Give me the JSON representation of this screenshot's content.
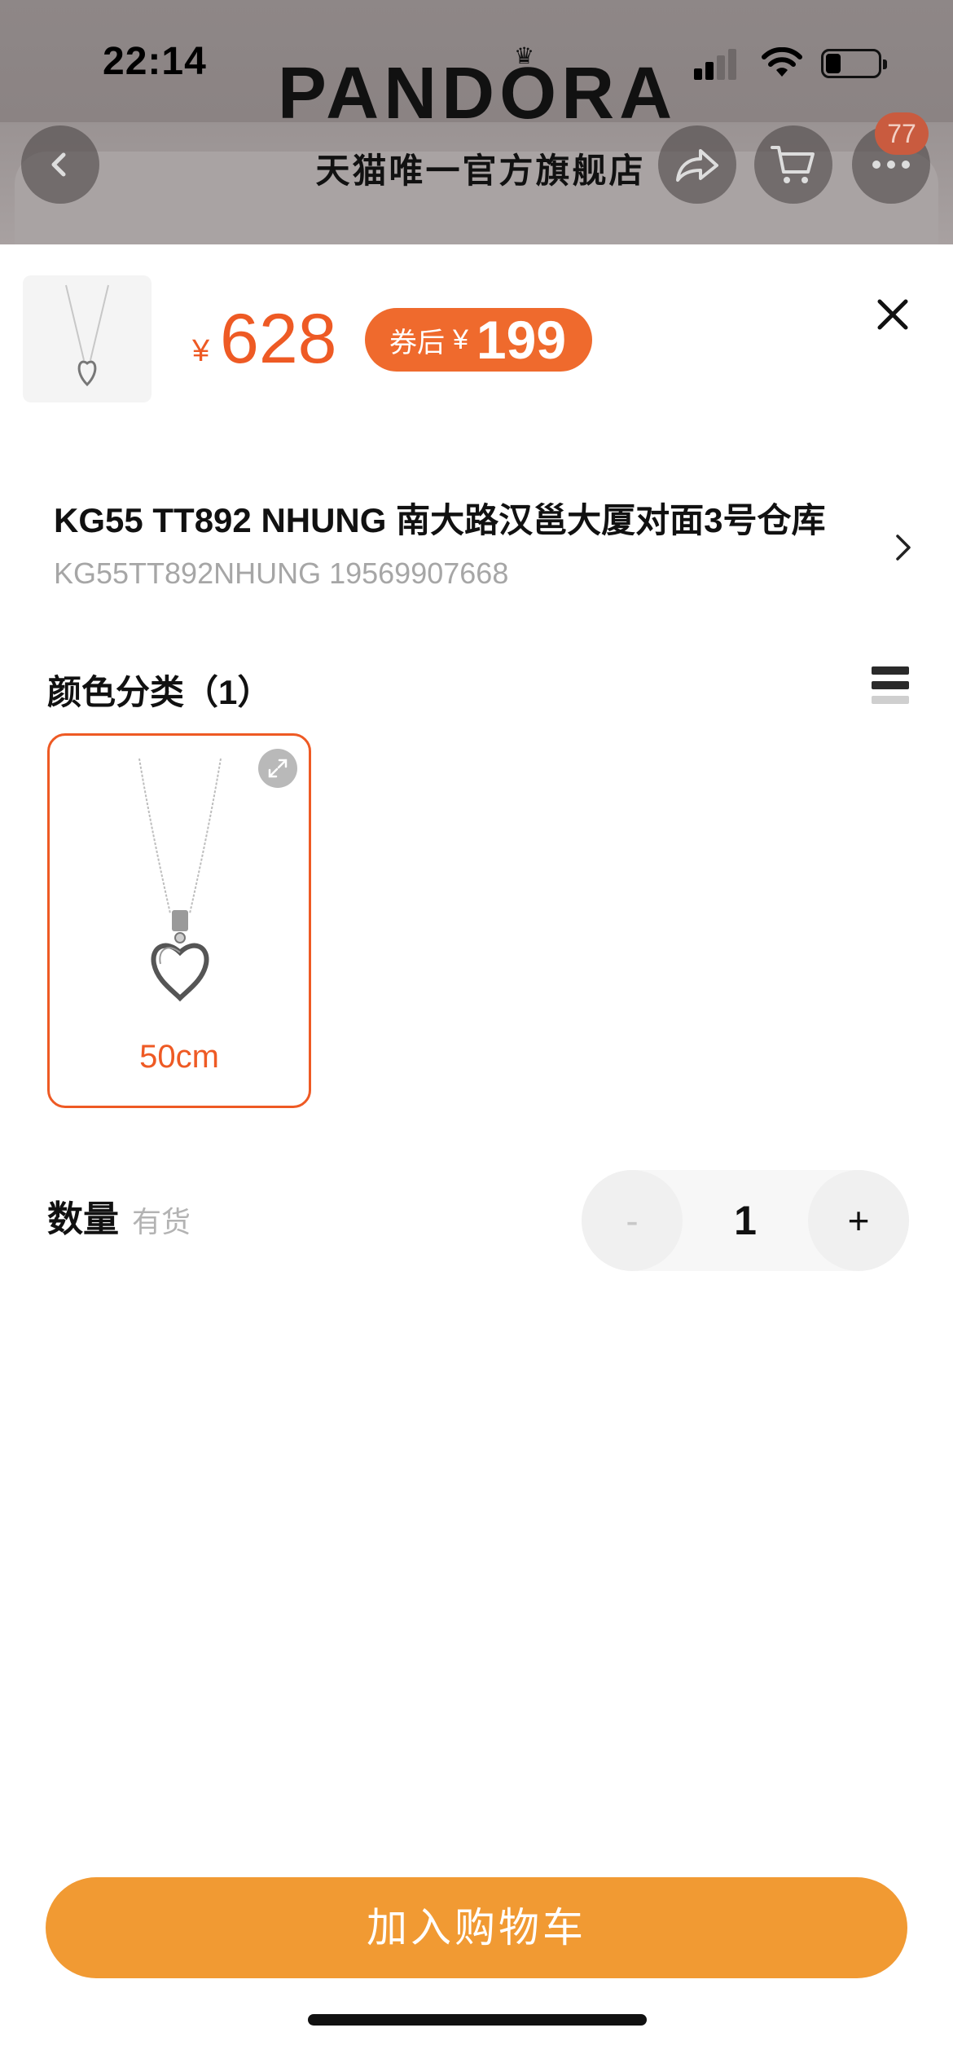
{
  "status_bar": {
    "time": "22:14"
  },
  "store_header": {
    "brand": "PANDORA",
    "crown": "♛",
    "subtitle": "天猫唯一官方旗舰店",
    "more_badge_count": "77"
  },
  "product": {
    "price_currency": "¥",
    "price": "628",
    "coupon_label": "券后",
    "coupon_currency": "¥",
    "coupon_price": "199"
  },
  "address": {
    "title": "KG55 TT892 NHUNG  南大路汉邕大厦对面3号仓库",
    "subtitle": "KG55TT892NHUNG 19569907668"
  },
  "variants": {
    "section_title": "颜色分类（1）",
    "items": [
      {
        "label": "50cm",
        "selected": true
      }
    ]
  },
  "quantity": {
    "label": "数量",
    "stock_status": "有货",
    "minus": "-",
    "value": "1",
    "plus": "+"
  },
  "actions": {
    "add_to_cart": "加入购物车"
  },
  "colors": {
    "accent_orange": "#ee5a24",
    "button_orange": "#f19a33",
    "badge_red": "#c95b3f"
  },
  "icons": [
    "back-arrow-icon",
    "share-icon",
    "cart-icon",
    "more-icon",
    "close-icon",
    "chevron-right-icon",
    "list-view-icon",
    "expand-icon"
  ]
}
